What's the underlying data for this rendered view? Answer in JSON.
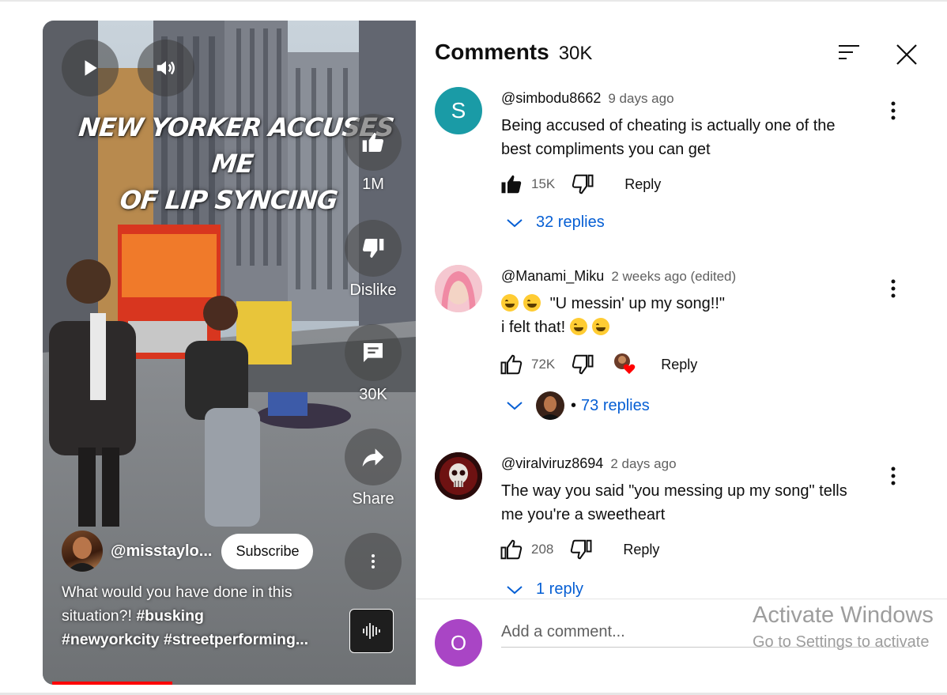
{
  "video": {
    "overlay_title_line1": "NEW YORKER ACCUSES ME",
    "overlay_title_line2": "OF LIP SYNCING",
    "like_count": "1M",
    "dislike_label": "Dislike",
    "comment_count": "30K",
    "share_label": "Share",
    "channel_name": "@misstaylo...",
    "subscribe_label": "Subscribe",
    "description_line1": "What would you have done in this",
    "description_line2_text": "situation?!",
    "description_line2_tag": "#busking",
    "description_line3": "#newyorkcity #streetperforming...",
    "progress": 0.34
  },
  "comments_panel": {
    "title": "Comments",
    "count": "30K",
    "comments": [
      {
        "avatar_letter": "S",
        "avatar_color": "#1a9ba6",
        "user": "@simbodu8662",
        "time": "9 days ago",
        "text_line1": "Being accused of cheating is actually one of the",
        "text_line2": "best compliments you can get",
        "likes": "15K",
        "reply_label": "Reply",
        "replies": "32 replies"
      },
      {
        "user": "@Manami_Miku",
        "time": "2 weeks ago (edited)",
        "text_line1": "\"U messin' up my song!!\"",
        "text_line2": "i felt that!",
        "likes": "72K",
        "reply_label": "Reply",
        "replies": "73 replies"
      },
      {
        "user": "@viralviruz8694",
        "time": "2 days ago",
        "text_line1": "The way you said \"you messing up my song\" tells",
        "text_line2": "me you're a sweetheart",
        "likes": "208",
        "reply_label": "Reply",
        "replies": "1 reply"
      }
    ],
    "add_comment": {
      "avatar_letter": "O",
      "avatar_color": "#a945c5",
      "placeholder": "Add a comment..."
    }
  },
  "watermark": {
    "line1": "Activate Windows",
    "line2": "Go to Settings to activate"
  }
}
